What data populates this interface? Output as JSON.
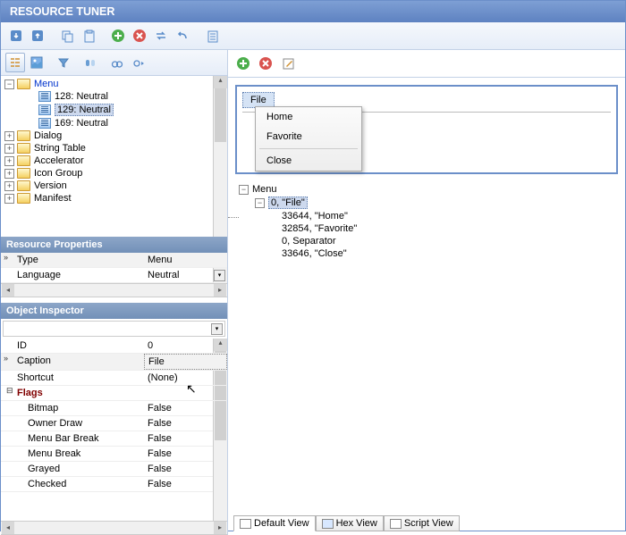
{
  "app_title": "RESOURCE TUNER",
  "tree": {
    "root": "Menu",
    "leaves": [
      "128: Neutral",
      "129: Neutral",
      "169: Neutral"
    ],
    "siblings": [
      "Dialog",
      "String Table",
      "Accelerator",
      "Icon Group",
      "Version",
      "Manifest"
    ]
  },
  "resource_props": {
    "header": "Resource Properties",
    "rows": [
      {
        "name": "Type",
        "value": "Menu"
      },
      {
        "name": "Language",
        "value": "Neutral"
      }
    ]
  },
  "inspector": {
    "header": "Object Inspector",
    "rows": [
      {
        "name": "ID",
        "value": "0"
      },
      {
        "name": "Caption",
        "value": "File"
      },
      {
        "name": "Shortcut",
        "value": "(None)"
      }
    ],
    "flags_label": "Flags",
    "flags": [
      {
        "name": "Bitmap",
        "value": "False"
      },
      {
        "name": "Owner Draw",
        "value": "False"
      },
      {
        "name": "Menu Bar Break",
        "value": "False"
      },
      {
        "name": "Menu Break",
        "value": "False"
      },
      {
        "name": "Grayed",
        "value": "False"
      },
      {
        "name": "Checked",
        "value": "False"
      }
    ]
  },
  "menu_preview": {
    "menubar_item": "File",
    "popup": [
      "Home",
      "Favorite",
      "Close"
    ]
  },
  "menu_tree": {
    "root": "Menu",
    "nodes": [
      {
        "text": "0, \"File\""
      },
      {
        "text": "33644, \"Home\""
      },
      {
        "text": "32854, \"Favorite\""
      },
      {
        "text": "0, Separator"
      },
      {
        "text": "33646, \"Close\""
      }
    ]
  },
  "view_tabs": [
    "Default View",
    "Hex View",
    "Script View"
  ]
}
